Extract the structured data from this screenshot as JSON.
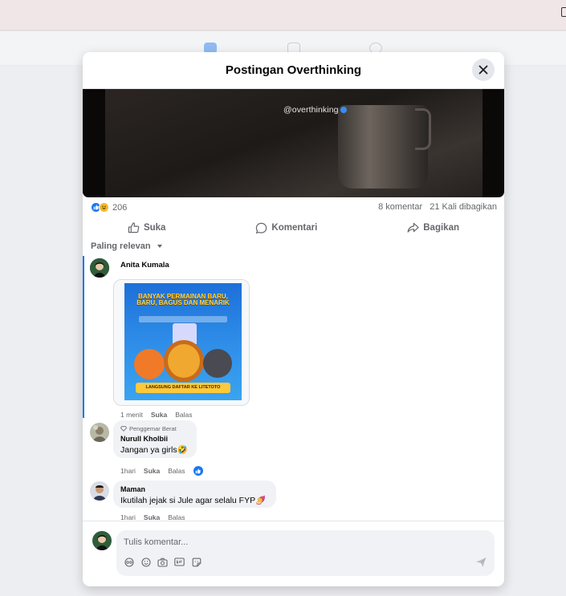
{
  "modal": {
    "title": "Postingan Overthinking",
    "close_label": "Tutup"
  },
  "post": {
    "media_watermark": "@overthinking",
    "reaction_count": "206",
    "comment_count": "8 komentar",
    "share_count": "21 Kali dibagikan"
  },
  "actions": {
    "like": "Suka",
    "comment": "Komentari",
    "share": "Bagikan"
  },
  "sort": {
    "label": "Paling relevan"
  },
  "comments": [
    {
      "name": "Anita Kumala",
      "text": "",
      "time": "1 menit",
      "like_label": "Suka",
      "reply_label": "Balas",
      "ad": {
        "title_line1": "BANYAK PERMAINAN BARU,",
        "title_line2": "BARU, BAGUS DAN MENARIK",
        "banner": "LANGSUNG DAFTAR KE LITETOTO"
      }
    },
    {
      "badge": "Penggemar Berat",
      "name": "Nurull Kholbii",
      "text": "Jangan ya girls🤣",
      "time": "1hari",
      "like_label": "Suka",
      "reply_label": "Balas"
    },
    {
      "name": "Maman",
      "text": "Ikutilah jejak si Jule agar selalu FYP🍠",
      "time": "1hari",
      "like_label": "Suka",
      "reply_label": "Balas"
    }
  ],
  "composer": {
    "placeholder": "Tulis komentar..."
  },
  "colors": {
    "accent": "#1877f2",
    "bubble": "#f0f2f5",
    "muted_text": "#65676b"
  }
}
